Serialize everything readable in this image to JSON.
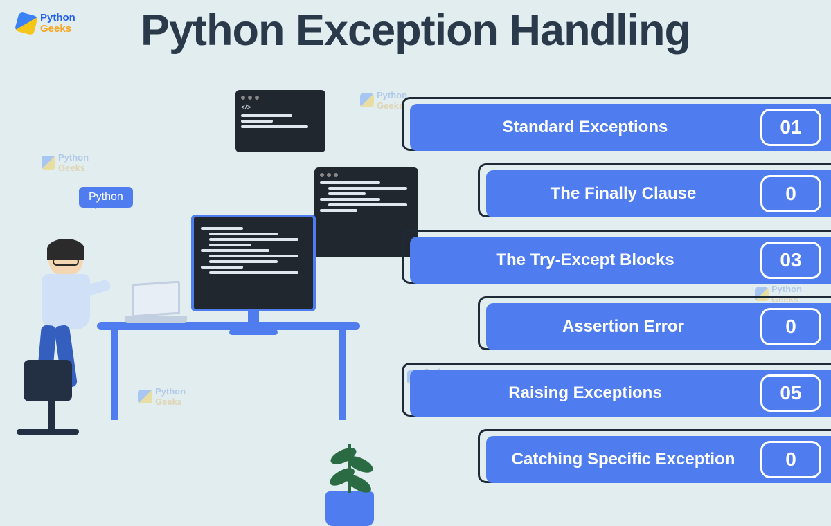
{
  "brand": {
    "name_top": "Python",
    "name_bottom": "Geeks"
  },
  "title": "Python Exception Handling",
  "speech_label": "Python",
  "topics": [
    {
      "label": "Standard Exceptions",
      "num": "01"
    },
    {
      "label": "The Finally Clause",
      "num": "0"
    },
    {
      "label": "The Try-Except Blocks",
      "num": "03"
    },
    {
      "label": "Assertion Error",
      "num": "0"
    },
    {
      "label": "Raising Exceptions",
      "num": "05"
    },
    {
      "label": "Catching Specific Exception",
      "num": "0"
    }
  ],
  "watermark": {
    "top": "Python",
    "bottom": "Geeks"
  },
  "colors": {
    "accent": "#4f7df0",
    "dark": "#20272f",
    "brandYellow": "#f5a623"
  }
}
